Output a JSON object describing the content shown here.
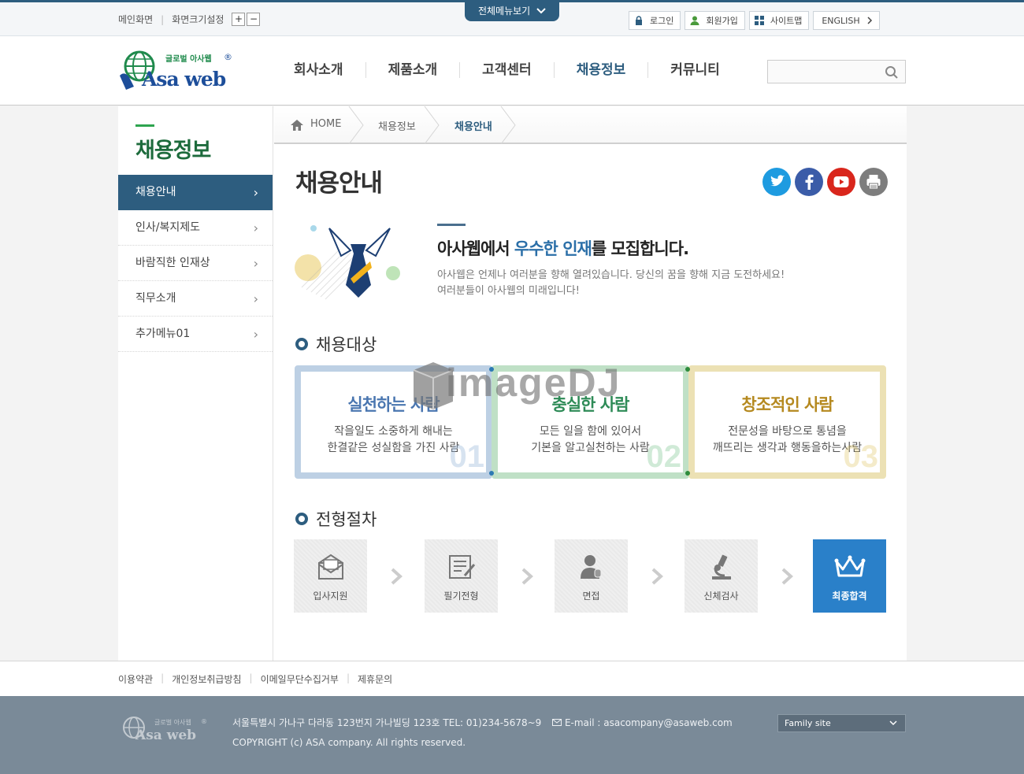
{
  "util": {
    "home": "메인화면",
    "font_size": "화면크기설정",
    "zoom_in": "+",
    "zoom_out": "−",
    "all_menu": "전체메뉴보기",
    "login": "로그인",
    "join": "회원가입",
    "sitemap": "사이트맵",
    "english": "ENGLISH"
  },
  "logo": {
    "top_text": "글로벌 아사웹",
    "main_text": "Asa web",
    "reg": "®"
  },
  "gnb": {
    "items": [
      "회사소개",
      "제품소개",
      "고객센터",
      "채용정보",
      "커뮤니티"
    ],
    "active_index": 3
  },
  "lnb": {
    "title": "채용정보",
    "items": [
      "채용안내",
      "인사/복지제도",
      "바람직한 인재상",
      "직무소개",
      "추가메뉴01"
    ],
    "active_index": 0
  },
  "breadcrumb": {
    "home": "HOME",
    "level1": "채용정보",
    "level2": "채용안내"
  },
  "page": {
    "title": "채용안내",
    "sns": [
      "twitter-icon",
      "facebook-icon",
      "youtube-icon",
      "print-icon"
    ]
  },
  "intro": {
    "headline_pre": "아사웹에서 ",
    "headline_hl": "우수한 인재",
    "headline_post": "를 모집합니다.",
    "desc_line1": "아사웹은 언제나 여러분을 향해 열려있습니다. 당신의 꿈을 향해 지금 도전하세요!",
    "desc_line2": "여러분들이 아사웹의 미래입니다!"
  },
  "targets": {
    "section_title": "채용대상",
    "items": [
      {
        "title": "실천하는 사람",
        "line1": "작을일도 소중하게 해내는",
        "line2": "한결같은 성실함을 가진 사람",
        "num": "01",
        "color": "#4a76b0",
        "border": "#bdd0e4"
      },
      {
        "title": "충실한 사람",
        "line1": "모든 일을 함에 있어서",
        "line2": "기본을 알고실천하는 사람",
        "num": "02",
        "color": "#2e8b57",
        "border": "#bfe0c6"
      },
      {
        "title": "창조적인 사람",
        "line1": "전문성을 바탕으로 통념을",
        "line2": "깨뜨리는 생각과 행동을하는사람",
        "num": "03",
        "color": "#b5891f",
        "border": "#ece1b4"
      }
    ]
  },
  "process": {
    "section_title": "전형절차",
    "steps": [
      "입사지원",
      "필기전형",
      "면접",
      "신체검사",
      "최종합격"
    ]
  },
  "footer": {
    "links": [
      "이용약관",
      "개인정보취급방침",
      "이메일무단수집거부",
      "제휴문의"
    ],
    "address": "서울특별시 가나구 다라동 123번지 가나빌딩 123호  TEL: 01)234-5678~9",
    "email": "E-mail : asacompany@asaweb.com",
    "copyright": "COPYRIGHT (c) ASA company. All rights reserved.",
    "family_site": "Family site"
  },
  "watermark": "imageDJ"
}
